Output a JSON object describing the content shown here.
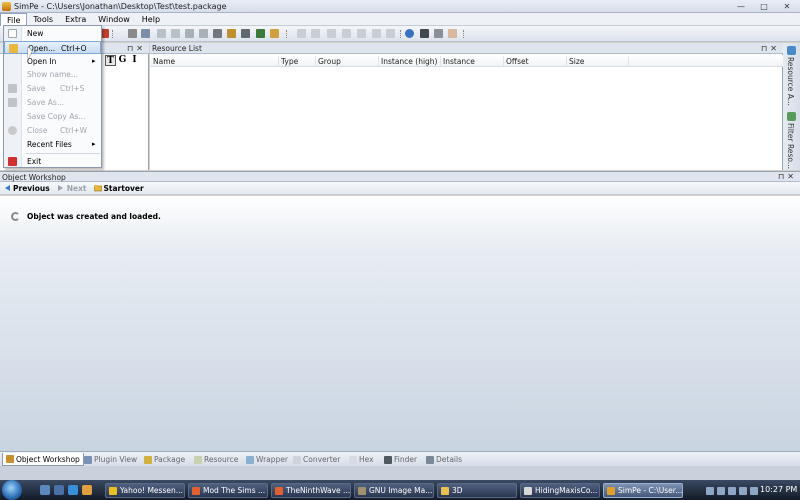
{
  "window": {
    "title": "SimPe - C:\\Users\\Jonathan\\Desktop\\Test\\test.package",
    "minimize": "—",
    "maximize": "□",
    "close": "✕"
  },
  "menubar": {
    "items": [
      "File",
      "Tools",
      "Extra",
      "Window",
      "Help"
    ],
    "active": "File"
  },
  "file_menu": {
    "items": [
      {
        "label": "New",
        "shortcut": "",
        "disabled": false,
        "submenu": false
      },
      {
        "label": "Open...",
        "shortcut": "Ctrl+O",
        "disabled": false,
        "submenu": false,
        "hover": true
      },
      {
        "label": "Open In",
        "shortcut": "",
        "disabled": false,
        "submenu": true
      },
      {
        "label": "Show name...",
        "shortcut": "",
        "disabled": true,
        "submenu": false
      },
      {
        "label": "Save",
        "shortcut": "Ctrl+S",
        "disabled": true,
        "submenu": false
      },
      {
        "label": "Save As...",
        "shortcut": "",
        "disabled": true,
        "submenu": false
      },
      {
        "label": "Save Copy As...",
        "shortcut": "",
        "disabled": true,
        "submenu": false
      },
      {
        "label": "Close",
        "shortcut": "Ctrl+W",
        "disabled": true,
        "submenu": false
      },
      {
        "label": "Recent Files",
        "shortcut": "",
        "disabled": false,
        "submenu": true
      },
      {
        "label": "Exit",
        "shortcut": "",
        "disabled": false,
        "submenu": false
      }
    ],
    "submenu_arrow": "▸"
  },
  "left_panel": {
    "sort_buttons": [
      "T",
      "G",
      "I"
    ],
    "pin": "⊓",
    "close": "✕"
  },
  "resource_list": {
    "title": "Resource List",
    "columns": [
      "Name",
      "Type",
      "Group",
      "Instance (high)",
      "Instance",
      "Offset",
      "Size"
    ]
  },
  "side_strip": {
    "tabs": [
      "Resource A...",
      "Filter Reso..."
    ]
  },
  "object_workshop": {
    "title": "Object Workshop",
    "nav": {
      "previous": "Previous",
      "next": "Next",
      "startover": "Startover"
    },
    "message": "Object was created and loaded."
  },
  "dock_tabs": [
    {
      "label": "Object Workshop",
      "active": true
    },
    {
      "label": "Plugin View",
      "active": false
    },
    {
      "label": "Package",
      "active": false
    },
    {
      "label": "Resource",
      "active": false
    },
    {
      "label": "Wrapper",
      "active": false
    },
    {
      "label": "Converter",
      "active": false
    },
    {
      "label": "Hex",
      "active": false
    },
    {
      "label": "Finder",
      "active": false
    },
    {
      "label": "Details",
      "active": false
    }
  ],
  "taskbar": {
    "tasks": [
      {
        "label": "Yahoo! Messen..."
      },
      {
        "label": "Mod The Sims ..."
      },
      {
        "label": "TheNinthWave ..."
      },
      {
        "label": "GNU Image Ma..."
      },
      {
        "label": "3D"
      },
      {
        "label": "HidingMaxisCo..."
      },
      {
        "label": "SimPe - C:\\User...",
        "active": true
      }
    ],
    "clock": "10:27 PM"
  }
}
